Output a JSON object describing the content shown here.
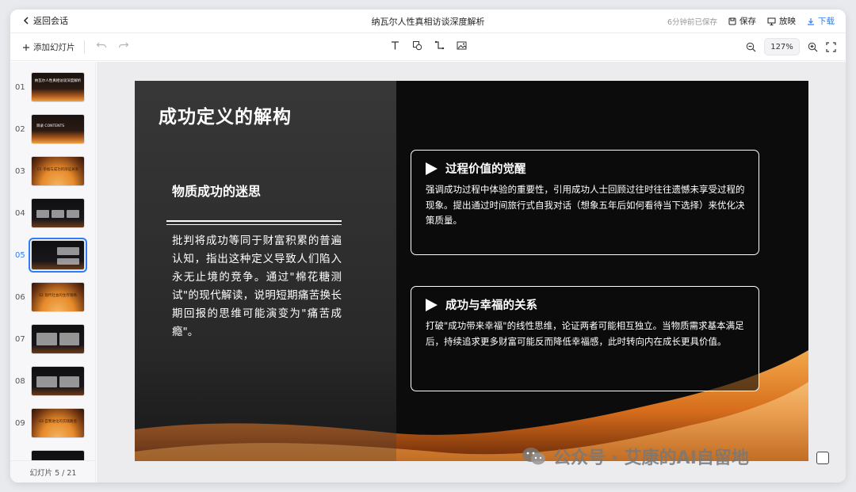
{
  "header": {
    "back_label": "返回会话",
    "doc_title": "纳瓦尔人性真相访谈深度解析",
    "saved_status": "6分钟前已保存",
    "save_label": "保存",
    "present_label": "放映",
    "download_label": "下载"
  },
  "toolbar": {
    "add_slide_label": "添加幻灯片",
    "zoom_level": "127%"
  },
  "sidebar": {
    "thumbnails": [
      {
        "num": "01",
        "text": "纳瓦尔人性真相访谈深度解析"
      },
      {
        "num": "02",
        "text": "目录 CONTENTS"
      },
      {
        "num": "03",
        "text": "01 幸福与成功的辩证关系"
      },
      {
        "num": "04",
        "text": ""
      },
      {
        "num": "05",
        "text": ""
      },
      {
        "num": "06",
        "text": "02 现代社会的生存策略"
      },
      {
        "num": "07",
        "text": ""
      },
      {
        "num": "08",
        "text": ""
      },
      {
        "num": "09",
        "text": "03 自我进化的实践路径"
      }
    ],
    "page_indicator": "幻灯片 5 / 21"
  },
  "slide": {
    "title": "成功定义的解构",
    "left": {
      "heading": "物质成功的迷思",
      "body": "批判将成功等同于财富积累的普遍认知，指出这种定义导致人们陷入永无止境的竞争。通过\"棉花糖测试\"的现代解读，说明短期痛苦换长期回报的思维可能演变为\"痛苦成瘾\"。"
    },
    "cards": [
      {
        "title": "过程价值的觉醒",
        "body": "强调成功过程中体验的重要性，引用成功人士回顾过往时往往遗憾未享受过程的现象。提出通过时间旅行式自我对话（想象五年后如何看待当下选择）来优化决策质量。"
      },
      {
        "title": "成功与幸福的关系",
        "body": "打破\"成功带来幸福\"的线性思维，论证两者可能相互独立。当物质需求基本满足后，持续追求更多财富可能反而降低幸福感，此时转向内在成长更具价值。"
      }
    ]
  },
  "watermark": "公众号 · 艾康的AI自留地",
  "colors": {
    "accent": "#2f7df6",
    "slide_bg": "#0c0c0c",
    "glow": "#f09a3c"
  }
}
